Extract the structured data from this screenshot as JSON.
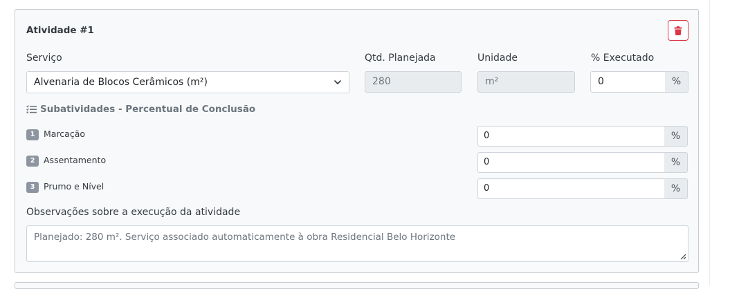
{
  "activity": {
    "title": "Atividade #1",
    "service": {
      "label": "Serviço",
      "selected": "Alvenaria de Blocos Cerâmicos (m²)"
    },
    "planned_qty": {
      "label": "Qtd. Planejada",
      "value": "280"
    },
    "unit": {
      "label": "Unidade",
      "value": "m²"
    },
    "executed": {
      "label": "% Executado",
      "value": "0",
      "suffix": "%"
    },
    "subactivities": {
      "heading": "Subatividades - Percentual de Conclusão",
      "items": [
        {
          "number": "1",
          "label": "Marcação",
          "value": "0",
          "suffix": "%"
        },
        {
          "number": "2",
          "label": "Assentamento",
          "value": "0",
          "suffix": "%"
        },
        {
          "number": "3",
          "label": "Prumo e Nível",
          "value": "0",
          "suffix": "%"
        }
      ]
    },
    "notes": {
      "label": "Observações sobre a execução da atividade",
      "value": "Planejado: 280 m². Serviço associado automaticamente à obra Residencial Belo Horizonte"
    }
  },
  "colors": {
    "danger": "#dc3545",
    "card_background": "#f8f9fa",
    "input_border": "#ced4da",
    "disabled_background": "#e9ecef",
    "badge": "#8d96a0"
  },
  "icons": {
    "delete": "trash-icon",
    "dropdown": "chevron-down-icon",
    "subactivities": "list-check-icon",
    "resize": "resize-grip-icon"
  }
}
